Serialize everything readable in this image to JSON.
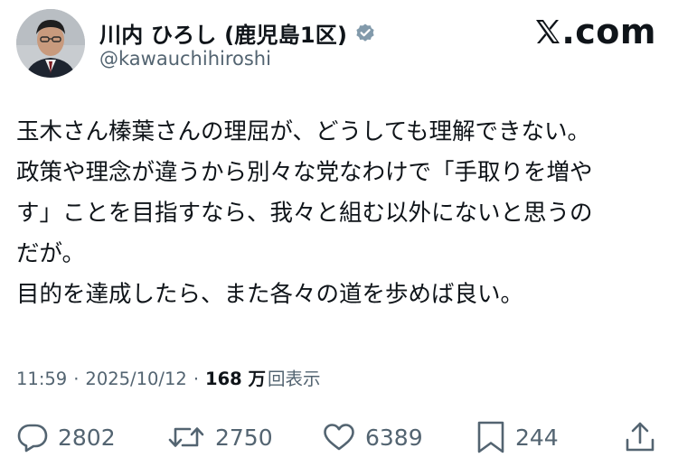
{
  "author": {
    "display_name": "川内 ひろし (鹿児島1区)",
    "handle": "@kawauchihiroshi",
    "verified": true
  },
  "brand": {
    "text": ".com"
  },
  "tweet": {
    "lines": [
      "玉木さん榛葉さんの理屈が、どうしても理解できない。",
      "政策や理念が違うから別々な党なわけで「手取りを増や",
      "す」ことを目指すなら、我々と組む以外にないと思うの",
      "だが。",
      "目的を達成したら、また各々の道を歩めば良い。"
    ]
  },
  "meta": {
    "time": "11:59",
    "separator": "·",
    "date": "2025/10/12",
    "views_count": "168 万",
    "views_label": "回表示"
  },
  "actions": {
    "replies": "2802",
    "reposts": "2750",
    "likes": "6389",
    "bookmarks": "244"
  },
  "colors": {
    "text_primary": "#0f1419",
    "text_secondary": "#536471",
    "verified_badge": "#829aab",
    "background": "#ffffff"
  }
}
